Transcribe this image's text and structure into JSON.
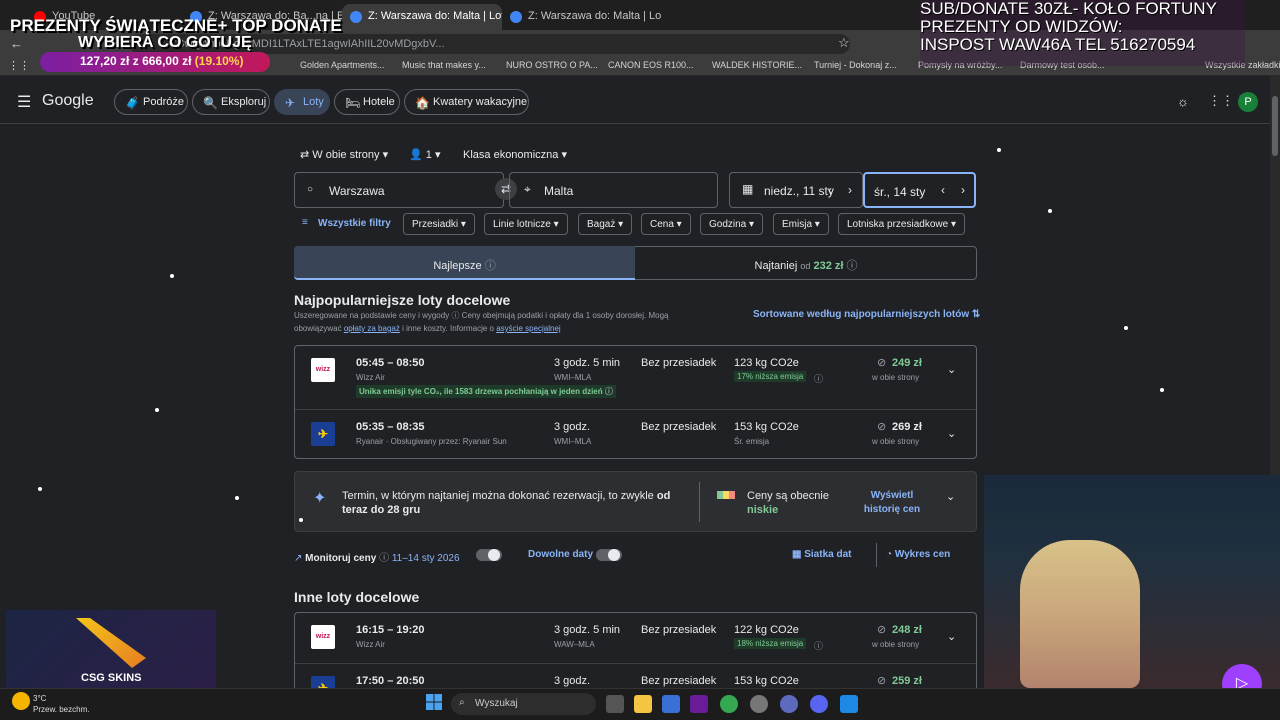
{
  "browser": {
    "tabs": [
      {
        "label": "YouTube",
        "active": false
      },
      {
        "label": "Z: Warszawa do: Ba...na | Eksplo",
        "active": false
      },
      {
        "label": "Z: Warszawa do: Malta | Loty G",
        "active": true
      },
      {
        "label": "Z: Warszawa do: Malta | Lo",
        "active": false
      }
    ],
    "url": "...CBwQAhoeEgoyMDI1LTAxLTE1agwIAhIIL20vMDgxbV...",
    "bookmarks": [
      "Golden Apartments...",
      "Music that makes y...",
      "NURO OSTRO O PA...",
      "CANON EOS R100...",
      "WALDEK HISTORIE...",
      "Turniej - Dokonaj z...",
      "Pomysły na wróżby...",
      "Darmowy test osob...",
      "Wszystkie zakładki"
    ]
  },
  "overlay": {
    "banner_title": "PREZENTY ŚWIĄTECZNE+ TOP DONATE",
    "banner_subtitle": "WYBIERA CO GOTUJĘ",
    "progress_amount": "127,20 zł",
    "progress_of": "z",
    "progress_goal": "666,00 zł",
    "progress_pct": "(19.10%)",
    "progress_fraction": 0.191,
    "donate_line1": "SUB/DONATE 30ZŁ- KOŁO FORTUNY",
    "donate_line2": "PREZENTY OD WIDZÓW:",
    "donate_line3": "INSPOST WAW46A TEL 516270594",
    "csgo_label": "CSG SKINS"
  },
  "header": {
    "logo": "Google",
    "nav": [
      {
        "label": "Podróże",
        "icon": "🧳"
      },
      {
        "label": "Eksploruj",
        "icon": "🔍"
      },
      {
        "label": "Loty",
        "icon": "✈"
      },
      {
        "label": "Hotele",
        "icon": "🛏"
      },
      {
        "label": "Kwatery wakacyjne",
        "icon": "🏠"
      }
    ],
    "avatar_letter": "P"
  },
  "search": {
    "trip_type": "W obie strony",
    "passengers": "1",
    "cabin_class": "Klasa ekonomiczna",
    "origin": "Warszawa",
    "destination": "Malta",
    "depart_date": "niedz., 11 sty",
    "return_date": "śr., 14 sty"
  },
  "filters": {
    "all_label": "Wszystkie filtry",
    "chips": [
      "Przesiadki",
      "Linie lotnicze",
      "Bagaż",
      "Cena",
      "Godzina",
      "Emisja",
      "Lotniska przesiadkowe"
    ]
  },
  "sort": {
    "best_label": "Najlepsze",
    "cheapest_label": "Najtaniej",
    "cheapest_from": "od",
    "cheapest_price": "232 zł"
  },
  "top_section": {
    "title": "Najpopularniejsze loty docelowe",
    "desc_line1": "Uszeregowane na podstawie ceny i wygody",
    "desc_line1b": "Ceny obejmują podatki i opłaty dla 1 osoby dorosłej. Mogą",
    "desc_line2a": "obowiązywać",
    "desc_link1": "opłaty za bagaż",
    "desc_line2b": "i inne koszty. Informacje o",
    "desc_link2": "asyście specjalnej",
    "sort_link": "Sortowane według najpopularniejszych lotów"
  },
  "flights_top": [
    {
      "times": "05:45 – 08:50",
      "airline": "Wizz Air",
      "logo": "wizz",
      "eco_note": "Unika emisji tyle CO₂, ile 1583 drzewa pochłaniają w jeden dzień",
      "duration": "3 godz. 5 min",
      "route": "WMI–MLA",
      "stops": "Bez przesiadek",
      "co2": "123 kg CO2e",
      "co2_note": "17% niższa emisja",
      "price": "249 zł",
      "price_note": "w obie strony",
      "cheap": true
    },
    {
      "times": "05:35 – 08:35",
      "airline": "Ryanair · Obsługiwany przez: Ryanair Sun",
      "logo": "ryanair",
      "duration": "3 godz.",
      "route": "WMI–MLA",
      "stops": "Bez przesiadek",
      "co2": "153 kg CO2e",
      "co2_note": "Śr. emisja",
      "price": "269 zł",
      "price_note": "w obie strony",
      "cheap": false
    }
  ],
  "insight": {
    "text_a": "Termin, w którym najtaniej można dokonać rezerwacji, to zwykle",
    "text_b": "od",
    "text_c": "teraz do 28 gru",
    "prices_now": "Ceny są obecnie",
    "prices_level": "niskie",
    "history_link": "Wyświetl historię cen"
  },
  "monitor": {
    "label": "Monitoruj ceny",
    "dates": "11–14 sty 2026",
    "any_dates": "Dowolne daty",
    "grid": "Siatka dat",
    "graph": "Wykres cen"
  },
  "other_section": {
    "title": "Inne loty docelowe"
  },
  "flights_other": [
    {
      "times": "16:15 – 19:20",
      "airline": "Wizz Air",
      "logo": "wizz",
      "duration": "3 godz. 5 min",
      "route": "WAW–MLA",
      "stops": "Bez przesiadek",
      "co2": "122 kg CO2e",
      "co2_note": "18% niższa emisja",
      "price": "248 zł",
      "price_note": "w obie strony",
      "cheap": true
    },
    {
      "times": "17:50 – 20:50",
      "airline": "Ryanair",
      "logo": "ryanair",
      "duration": "3 godz.",
      "route": "",
      "stops": "Bez przesiadek",
      "co2": "153 kg CO2e",
      "co2_note": "",
      "price": "259 zł",
      "price_note": "",
      "cheap": true
    }
  ],
  "taskbar": {
    "weather_temp": "3°C",
    "weather_desc": "Przew. bezchm.",
    "search_placeholder": "Wyszukaj"
  }
}
